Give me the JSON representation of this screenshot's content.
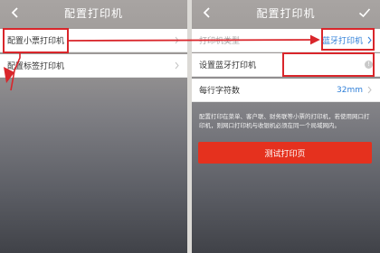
{
  "left_screen": {
    "nav_title": "配置打印机",
    "back_icon": "chevron-left-icon",
    "items": [
      {
        "label": "配置小票打印机"
      },
      {
        "label": "配置标签打印机"
      }
    ]
  },
  "right_screen": {
    "nav_title": "配置打印机",
    "back_icon": "chevron-left-icon",
    "confirm_icon": "checkmark-icon",
    "rows": [
      {
        "label": "打印机类型",
        "value": "蓝牙打印机"
      },
      {
        "label": "设置蓝牙打印机",
        "value": ""
      },
      {
        "label": "每行字符数",
        "value": "32mm"
      }
    ],
    "description": "配置打印在菜单、客户联、财务联等小票的打印机，若使用网口打印机，则网口打印机与收银机必须在同一个局域网内。",
    "test_button_label": "测试打印页"
  },
  "colors": {
    "accent_blue": "#2f7fd8",
    "highlight_red": "#d9262b",
    "button_red": "#e5311e"
  }
}
